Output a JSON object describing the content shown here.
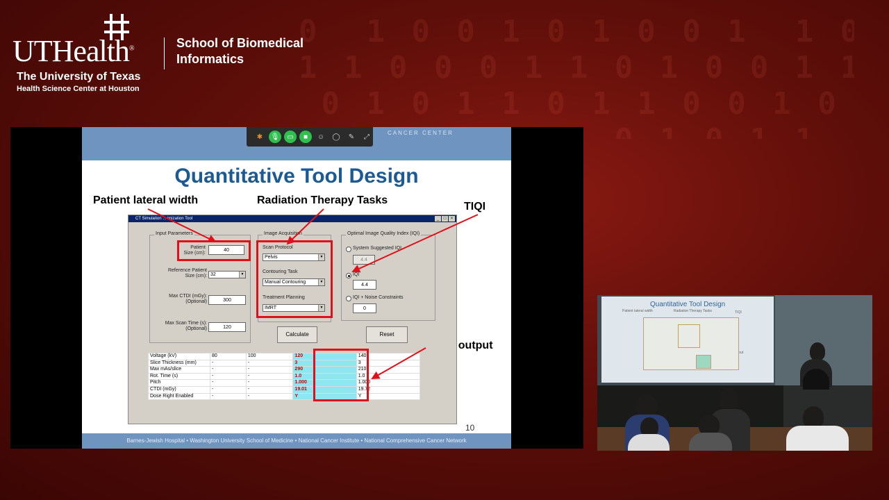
{
  "background_digits": "0  1 0 0 1 0 1 0 0 1  1 0\n1 1 0 0 0 1 1 0 1 0 0 1 1 0\n 0 1 0 1 1 0 1 1 0 0 1 0\n1 0 0 1 0 1 1 0 1 0 1 1",
  "branding": {
    "logo_text": "UTHealth",
    "school": "School of Biomedical Informatics",
    "university": "The University of Texas",
    "campus": "Health Science Center at Houston"
  },
  "meeting_toolbar": {
    "icons": [
      "app-icon",
      "microphone-icon",
      "screen-share-icon",
      "video-icon",
      "participants-icon",
      "chat-icon",
      "annotate-icon",
      "expand-icon"
    ]
  },
  "slide": {
    "header_text": "CANCER CENTER",
    "title": "Quantitative Tool Design",
    "annotations": {
      "patient_lateral_width": "Patient lateral width",
      "radiation_tasks": "Radiation Therapy Tasks",
      "tiqi": "TIQI",
      "final_output": "Final output"
    },
    "page_number": "10",
    "footer": "Barnes-Jewish Hospital  •  Washington University School of Medicine  •  National Cancer Institute  •  National Comprehensive Cancer Network"
  },
  "tool_window": {
    "title": "CT Simulation ... imization Tool",
    "input_parameters": {
      "group_label": "Input Parameters",
      "patient_size_label": "Patient\nSize (cm):",
      "patient_size_value": "40",
      "ref_size_label": "Reference Patient\nSize (cm):",
      "ref_size_value": "32",
      "max_ctdi_label": "Max CTDI (mGy):\n(Optional)",
      "max_ctdi_value": "300",
      "max_scan_label": "Max Scan Time (s):\n(Optional)",
      "max_scan_value": "120"
    },
    "image_acquisition": {
      "group_label": "Image Acquisition",
      "scan_protocol_label": "Scan Protocol",
      "scan_protocol_value": "Pelvis",
      "contouring_label": "Contouring Task",
      "contouring_value": "Manual Contouring",
      "treatment_label": "Treatment Planning",
      "treatment_value": "IMRT"
    },
    "iqi": {
      "group_label": "Optimal Image Quality Index (IQI)",
      "system_suggested_label": "System Suggested IQI",
      "system_suggested_value": "4.4",
      "iqi_label": "IQI",
      "iqi_value": "4.4",
      "noise_label": "IQI + Noise Constraints",
      "noise_value": "0",
      "selected": "IQI"
    },
    "calculate_label": "Calculate",
    "reset_label": "Reset",
    "results": [
      [
        "Voltage (kV)",
        "80",
        "100",
        "120",
        "140"
      ],
      [
        "Slice Thickness (mm)",
        "-",
        "-",
        "3",
        "3"
      ],
      [
        "Max mAs/slice",
        "-",
        "-",
        "290",
        "210"
      ],
      [
        "Rot. Time (s)",
        "-",
        "-",
        "1.0",
        "1.0"
      ],
      [
        "Pitch",
        "-",
        "-",
        "1.000",
        "1.000"
      ],
      [
        "CTDI (mGy)",
        "-",
        "-",
        "19.01",
        "19.72"
      ],
      [
        "Dose Right Enabled",
        "-",
        "-",
        "Y",
        "Y"
      ]
    ]
  },
  "camera": {
    "screen_title": "Quantitative Tool Design",
    "screen_labels": [
      "Patient lateral width",
      "Radiation Therapy Tasks",
      "TIQI",
      "Final output"
    ]
  }
}
